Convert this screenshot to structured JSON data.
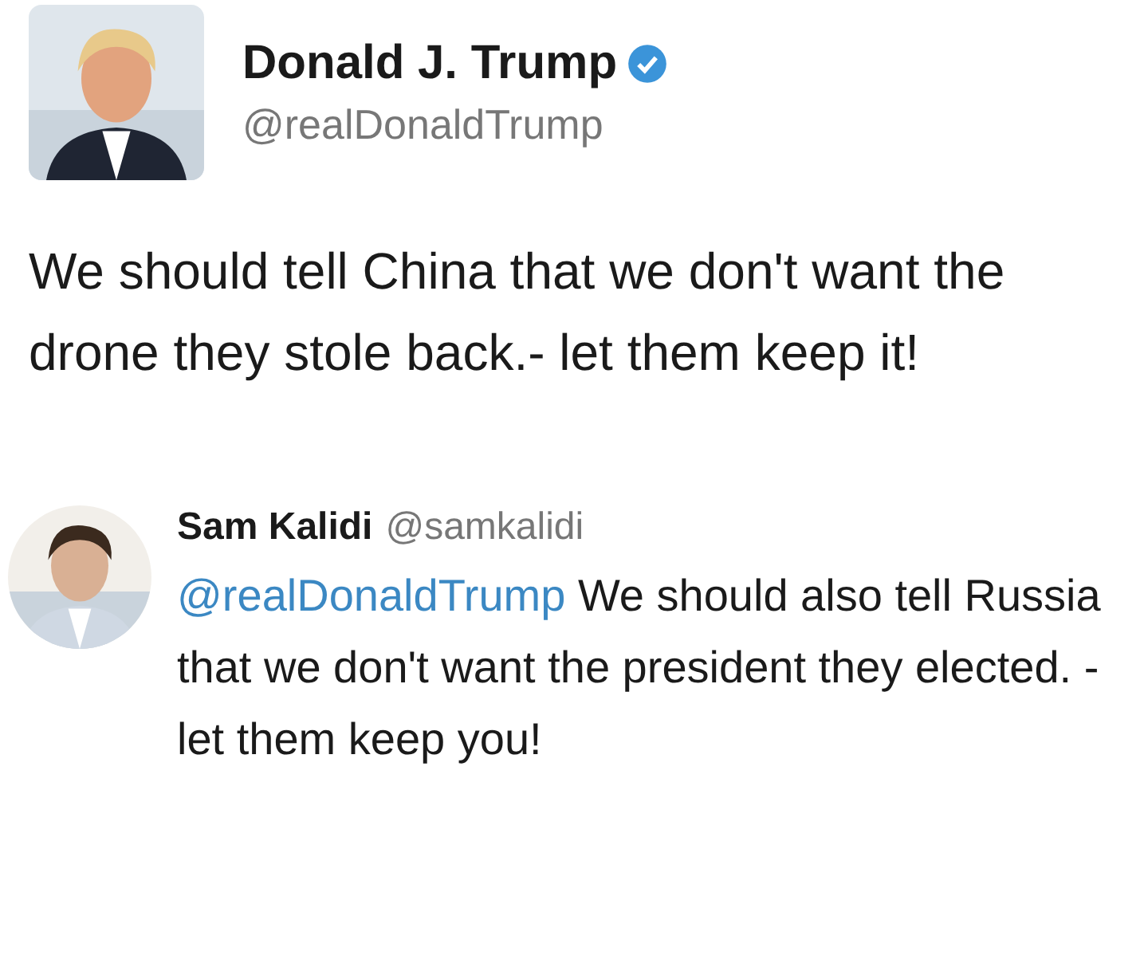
{
  "tweet": {
    "author": {
      "name": "Donald J. Trump",
      "verified": true,
      "handle": "@realDonaldTrump"
    },
    "text": "We should tell China that we don't want the drone they stole back.- let them keep it!"
  },
  "reply": {
    "author": {
      "name": "Sam Kalidi",
      "handle": "@samkalidi"
    },
    "mention": "@realDonaldTrump",
    "text": "We should also tell Russia that we don't want the president they elected. -let them keep you!"
  }
}
